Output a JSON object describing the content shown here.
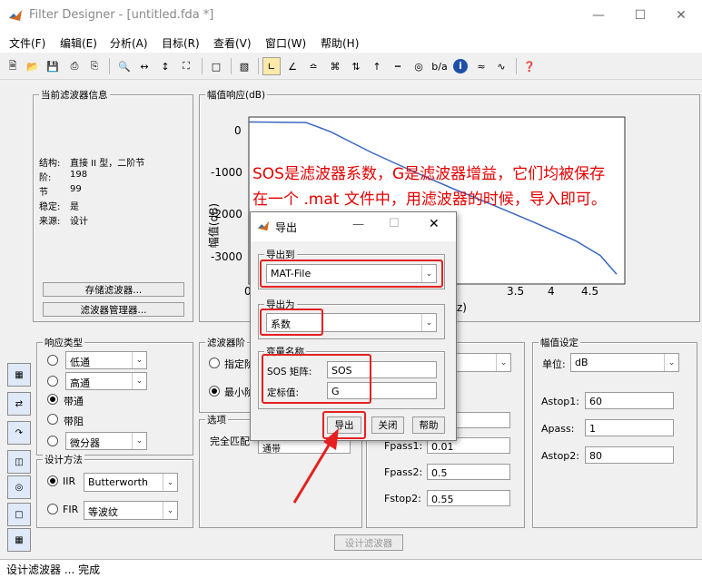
{
  "window": {
    "title": "Filter Designer - [untitled.fda *]"
  },
  "menu": [
    "文件(F)",
    "编辑(E)",
    "分析(A)",
    "目标(R)",
    "查看(V)",
    "窗口(W)",
    "帮助(H)"
  ],
  "info_panel": {
    "title": "当前滤波器信息",
    "rows": [
      {
        "label": "结构:",
        "value": "直接 II 型，二阶节"
      },
      {
        "label": "阶:",
        "value": "198"
      },
      {
        "label": "节",
        "value": "99"
      },
      {
        "label": "稳定:",
        "value": "是"
      },
      {
        "label": "来源:",
        "value": "设计"
      }
    ],
    "store_button": "存储滤波器...",
    "manager_button": "滤波器管理器..."
  },
  "plot": {
    "title": "幅值响应(dB)",
    "ylabel": "幅值(dB)",
    "xlabel_partial": "z)",
    "y_ticks": [
      "0",
      "-1000",
      "-2000",
      "-3000"
    ],
    "x_ticks": [
      "0",
      "3.5",
      "4",
      "4.5"
    ]
  },
  "chart_data": {
    "type": "line",
    "title": "幅值响应(dB)",
    "ylabel": "幅值(dB)",
    "xlim": [
      0,
      4.6
    ],
    "ylim": [
      -3300,
      100
    ],
    "series": [
      {
        "x": [
          0,
          0.7,
          1,
          1.5,
          2,
          2.5,
          3,
          3.5,
          4,
          4.3,
          4.5
        ],
        "y": [
          0,
          -10,
          -200,
          -620,
          -1000,
          -1360,
          -1700,
          -2050,
          -2420,
          -2720,
          -3100
        ]
      }
    ]
  },
  "annotation": {
    "line1": "SOS是滤波器系数，G是滤波器增益，它们均被保存",
    "line2": "在一个 .mat 文件中，用滤波器的时候，导入即可。"
  },
  "response_type": {
    "title": "响应类型",
    "options": [
      "低通",
      "高通",
      "带通",
      "带阻",
      "微分器"
    ],
    "selected": "带通"
  },
  "design_method": {
    "title": "设计方法",
    "iir_label": "IIR",
    "iir_value": "Butterworth",
    "fir_label": "FIR",
    "fir_value": "等波纹",
    "selected": "IIR"
  },
  "filter_order": {
    "title_partial": "滤波器阶",
    "specify_partial": "指定阶",
    "min_partial": "最小阶"
  },
  "options_panel": {
    "title": "选项",
    "match_partial": "完全匹配",
    "match_value_partial": "通带"
  },
  "freq_spec": {
    "fpass1_label": "Fpass1:",
    "fpass1_value": "0.01",
    "fpass2_label": "Fpass2:",
    "fpass2_value": "0.5",
    "fstop2_label": "Fstop2:",
    "fstop2_value": "0.55"
  },
  "mag_spec": {
    "title": "幅值设定",
    "unit_label": "单位:",
    "unit_value": "dB",
    "astop1_label": "Astop1:",
    "astop1_value": "60",
    "apass_label": "Apass:",
    "apass_value": "1",
    "astop2_label": "Astop2:",
    "astop2_value": "80"
  },
  "design_button": "设计滤波器",
  "status": "设计滤波器 ... 完成",
  "dialog": {
    "title": "导出",
    "export_to_title": "导出到",
    "export_to_value": "MAT-File",
    "export_as_title": "导出为",
    "export_as_value": "系数",
    "varnames_title": "变量名称",
    "sos_label": "SOS 矩阵:",
    "sos_value": "SOS",
    "gain_label": "定标值:",
    "gain_value": "G",
    "export_button": "导出",
    "close_button": "关闭",
    "help_button": "帮助"
  },
  "colors": {
    "annotation": "#e60000",
    "curve": "#3a66c0",
    "highlight": "#e62020"
  }
}
